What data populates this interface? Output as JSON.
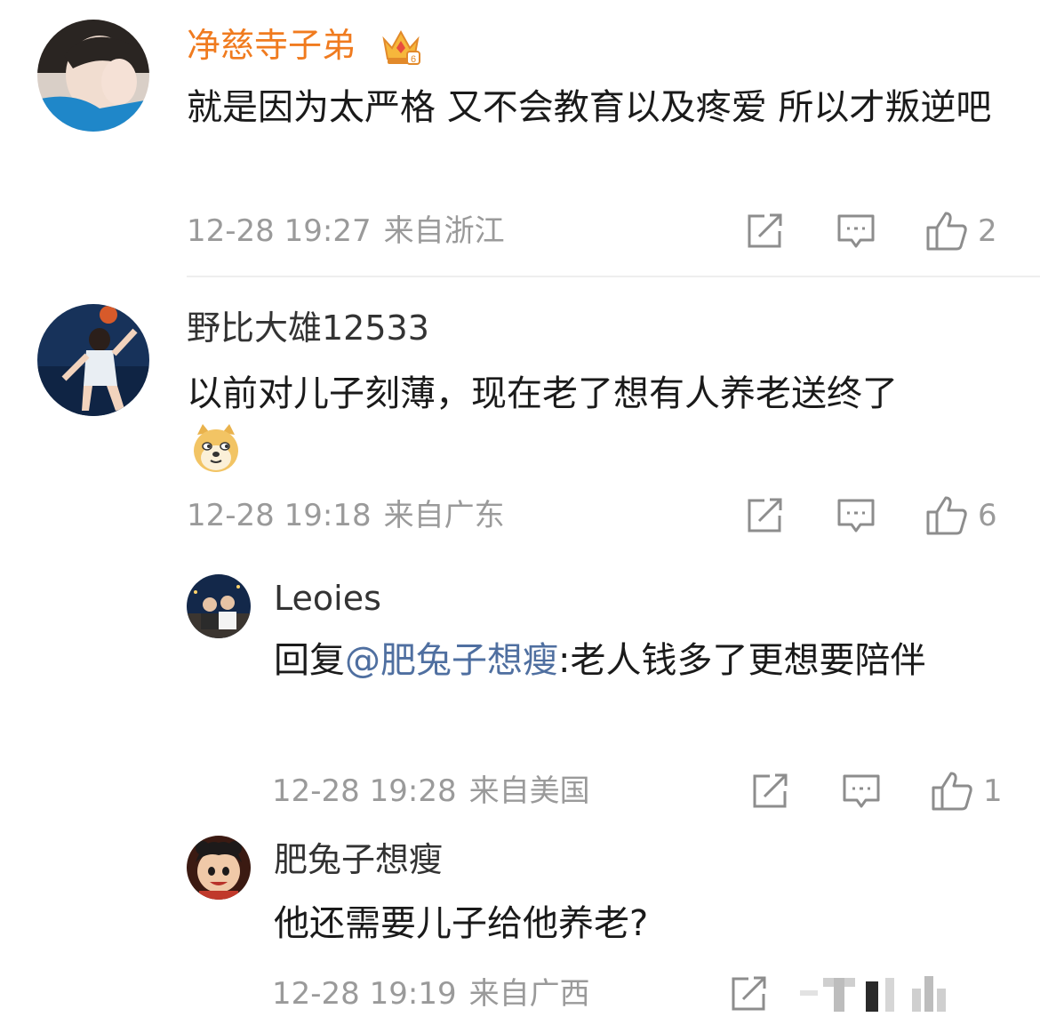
{
  "comments": [
    {
      "username": "净慈寺子弟",
      "badge_icon": "crown-badge-icon",
      "text": "就是因为太严格 又不会教育以及疼爱 所以才叛逆吧",
      "date": "12-28 19:27",
      "location": "来自浙江",
      "likes": "2"
    },
    {
      "username": "野比大雄12533",
      "text": "以前对儿子刻薄，现在老了想有人养老送终了",
      "emoji": "doge-emoji",
      "date": "12-28 19:18",
      "location": "来自广东",
      "likes": "6"
    }
  ],
  "replies": [
    {
      "username": "Leoies",
      "reply_prefix": "回复",
      "mention": "@肥兔子想瘦",
      "text": ":老人钱多了更想要陪伴",
      "date": "12-28 19:28",
      "location": "来自美国",
      "likes": "1"
    },
    {
      "username": "肥兔子想瘦",
      "text": "他还需要儿子给他养老?",
      "date": "12-28 19:19",
      "location": "来自广西"
    }
  ],
  "colors": {
    "vip_username": "#f07b1f",
    "mention": "#4f6fa0",
    "meta": "#9a9a9a"
  }
}
